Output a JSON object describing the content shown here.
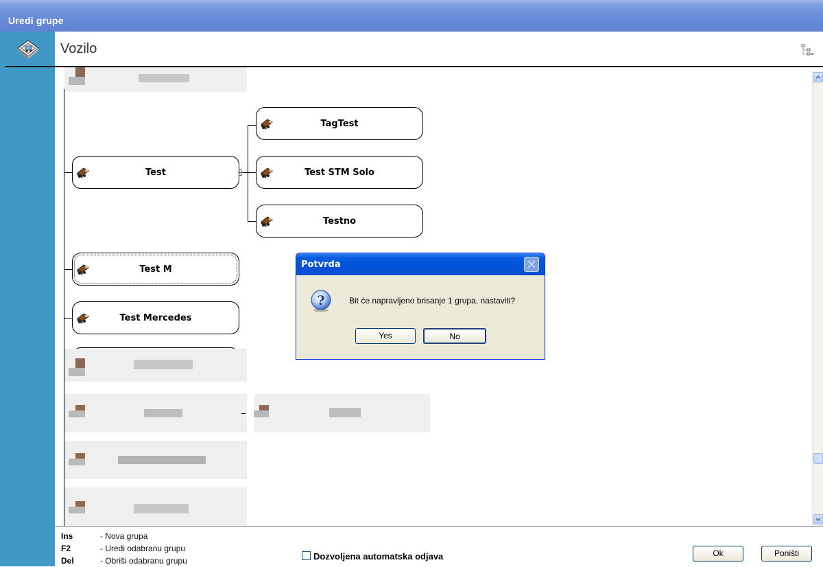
{
  "window": {
    "title": "Uredi grupe"
  },
  "header": {
    "title": "Vozilo"
  },
  "tree": {
    "nodes": [
      {
        "label": "Test"
      },
      {
        "label": "TagTest"
      },
      {
        "label": "Test STM Solo"
      },
      {
        "label": "Testno"
      },
      {
        "label": "Test M"
      },
      {
        "label": "Test Mercedes"
      }
    ]
  },
  "footer": {
    "shortcuts": [
      {
        "key": "Ins",
        "desc": "- Nova grupa"
      },
      {
        "key": "F2",
        "desc": "- Uredi odabranu grupu"
      },
      {
        "key": "Del",
        "desc": "- Obriši odabranu grupu"
      }
    ],
    "checkbox_label": "Dozvoljena automatska odjava",
    "checkbox_checked": false,
    "ok_label": "Ok",
    "cancel_label": "Poništi"
  },
  "dialog": {
    "title": "Potvrda",
    "message": "Bit će napravljeno brisanje 1 grupa, nastaviti?",
    "yes_label": "Yes",
    "no_label": "No",
    "icon": "question-icon"
  },
  "icons": {
    "app": "vehicle-group-icon",
    "tree_view": "tree-view-icon",
    "node": "truck-icon"
  },
  "colors": {
    "titlebar": "#6c8fda",
    "sidebar": "#3f98c6",
    "dialog_titlebar": "#0053d9",
    "dialog_bg": "#ece9d8"
  }
}
